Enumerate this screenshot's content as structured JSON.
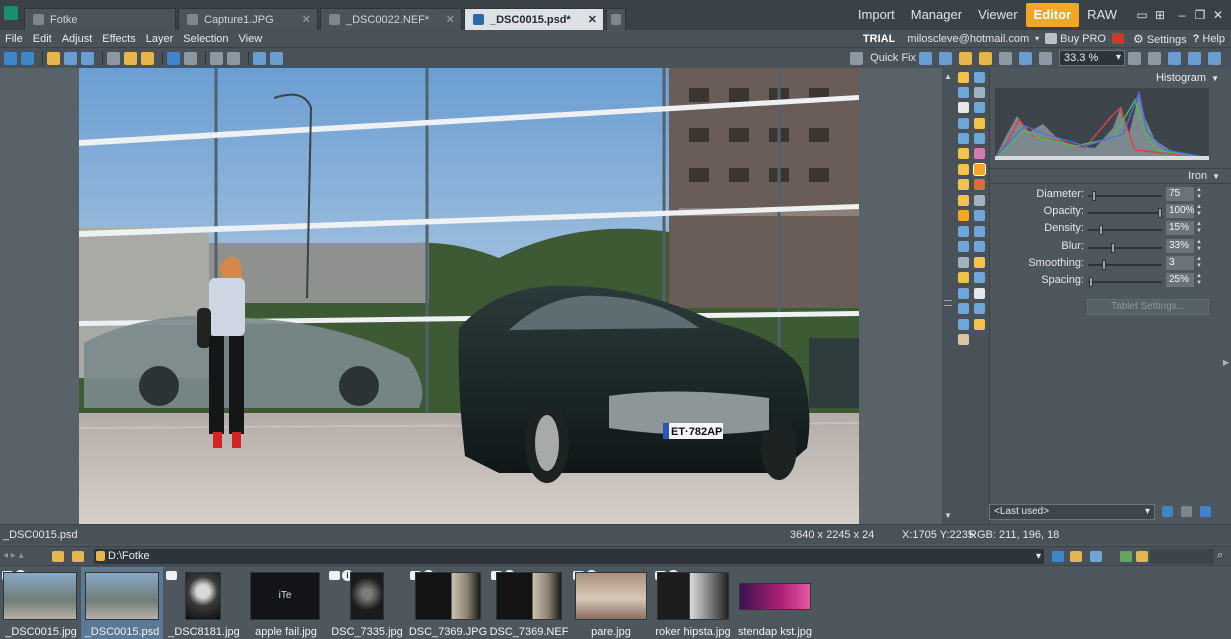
{
  "tabs": [
    {
      "label": "Fotke",
      "active": false
    },
    {
      "label": "Capture1.JPG",
      "active": false
    },
    {
      "label": "_DSC0022.NEF*",
      "active": false
    },
    {
      "label": "_DSC0015.psd*",
      "active": true
    }
  ],
  "modes": [
    "Import",
    "Manager",
    "Viewer",
    "Editor",
    "RAW"
  ],
  "active_mode": "Editor",
  "menus": [
    "File",
    "Edit",
    "Adjust",
    "Effects",
    "Layer",
    "Selection",
    "View"
  ],
  "account": {
    "trial": "TRIAL",
    "email": "miloscleve@hotmail.com",
    "buy": "Buy PRO",
    "settings": "Settings",
    "help": "Help",
    "notif_count": "10"
  },
  "toolbar": {
    "quick_fix": "Quick Fix",
    "zoom": "33.3 %"
  },
  "panel": {
    "histogram_label": "Histogram",
    "tool_label": "Iron",
    "params": [
      {
        "label": "Diameter:",
        "value": "75",
        "level": 0.05
      },
      {
        "label": "Opacity:",
        "value": "100%",
        "level": 1.0
      },
      {
        "label": "Density:",
        "value": "15%",
        "level": 0.15
      },
      {
        "label": "Blur:",
        "value": "33%",
        "level": 0.33
      },
      {
        "label": "Smoothing:",
        "value": "3",
        "level": 0.2
      },
      {
        "label": "Spacing:",
        "value": "25%",
        "level": 0.02
      }
    ],
    "tablet_settings": "Tablet Settings...",
    "preset": "<Last used>"
  },
  "photo": {
    "plate": "ET·782AP"
  },
  "status": {
    "filename": "_DSC0015.psd",
    "dimensions": "3640 x 2245 x 24",
    "coords": "X:1705 Y:2235",
    "rgb": "RGB: 211, 196, 18"
  },
  "browser": {
    "path": "D:\\Fotke"
  },
  "thumbnails": [
    {
      "name": "_DSC0015.jpg",
      "selected": false
    },
    {
      "name": "_DSC0015.psd",
      "selected": true
    },
    {
      "name": "_DSC8181.jpg",
      "selected": false
    },
    {
      "name": "apple fail.jpg",
      "selected": false
    },
    {
      "name": "DSC_7335.jpg",
      "selected": false
    },
    {
      "name": "DSC_7369.JPG",
      "selected": false
    },
    {
      "name": "DSC_7369.NEF",
      "selected": false
    },
    {
      "name": "pare.jpg",
      "selected": false
    },
    {
      "name": "roker hipsta.jpg",
      "selected": false
    },
    {
      "name": "stendap kst.jpg",
      "selected": false
    }
  ],
  "colors": {
    "accent": "#f2a623",
    "panel": "#4f575e",
    "tab_active": "#dde1e4",
    "selection": "#5b7895"
  }
}
